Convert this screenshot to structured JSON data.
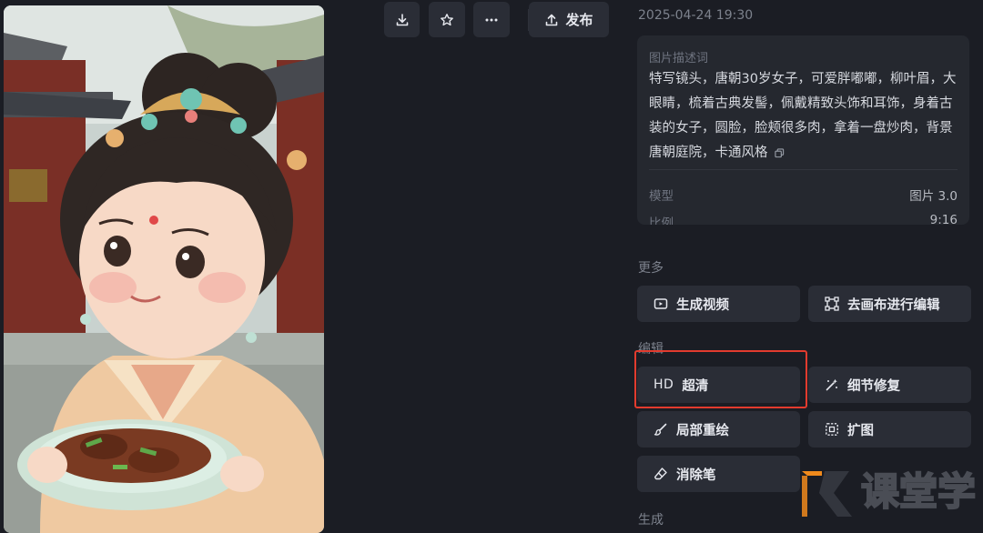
{
  "toolbar": {
    "download_icon": "download-icon",
    "favorite_icon": "star-icon",
    "more_icon": "more-icon",
    "publish_label": "发布"
  },
  "meta": {
    "timestamp": "2025-04-24 19:30"
  },
  "info": {
    "prompt_label": "图片描述词",
    "prompt_text": "特写镜头，唐朝30岁女子，可爱胖嘟嘟，柳叶眉，大眼睛，梳着古典发髻，佩戴精致头饰和耳饰，身着古装的女子，圆脸，脸颊很多肉，拿着一盘炒肉，背景唐朝庭院，卡通风格",
    "rows": [
      {
        "key": "模型",
        "value": "图片 3.0"
      },
      {
        "key": "比例",
        "value": "9:16"
      }
    ]
  },
  "sections": {
    "more_label": "更多",
    "edit_label": "编辑",
    "generate_label": "生成"
  },
  "actions": {
    "generate_video": "生成视频",
    "canvas_edit": "去画布进行编辑",
    "hd_prefix": "HD",
    "upscale": "超清",
    "detail_fix": "细节修复",
    "inpaint": "局部重绘",
    "expand": "扩图",
    "eraser": "消除笔"
  },
  "colors": {
    "background": "#1b1d24",
    "button": "#2a2d36",
    "highlight": "#e23b2e"
  }
}
